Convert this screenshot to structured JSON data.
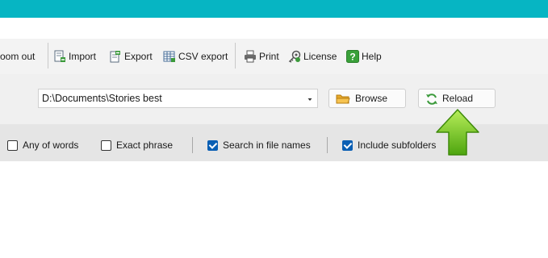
{
  "toolbar": {
    "zoom_out_label": "oom out",
    "import_label": "Import",
    "export_label": "Export",
    "csv_export_label": "CSV export",
    "print_label": "Print",
    "license_label": "License",
    "help_label": "Help"
  },
  "path": {
    "value": "D:\\Documents\\Stories best",
    "browse_label": "Browse",
    "reload_label": "Reload"
  },
  "filters": {
    "any_of_words": {
      "label": "Any of words",
      "checked": false
    },
    "exact_phrase": {
      "label": "Exact phrase",
      "checked": false
    },
    "search_in_file_names": {
      "label": "Search in file names",
      "checked": true
    },
    "include_subfolders": {
      "label": "Include subfolders",
      "checked": true
    }
  },
  "colors": {
    "title_strip": "#06b5c3",
    "checkbox_checked": "#0a5fb4",
    "highlight_arrow": "#6cc21e"
  },
  "icons": [
    "import-icon",
    "export-icon",
    "csv-export-icon",
    "print-icon",
    "license-icon",
    "help-icon",
    "folder-icon",
    "reload-icon",
    "chevron-down-icon",
    "up-arrow-icon"
  ]
}
